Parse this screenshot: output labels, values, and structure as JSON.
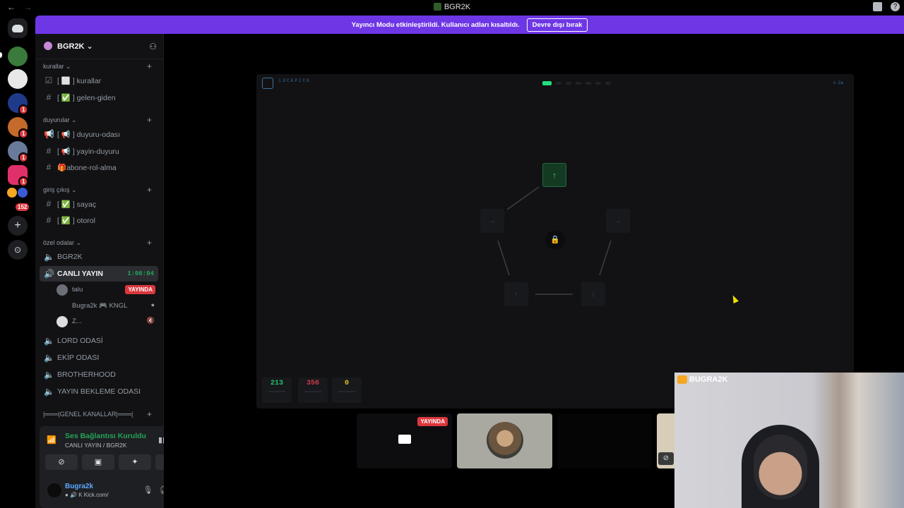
{
  "window": {
    "title": "BGR2K",
    "back": "←",
    "forward": "→"
  },
  "banner": {
    "text": "Yayıncı Modu etkinleştirildi. Kullanıcı adları kısaltıldı.",
    "button": "Devre dışı bırak"
  },
  "rail": {
    "badges": [
      "1",
      "1",
      "1",
      "1",
      "152"
    ],
    "add": "+",
    "explore": "⊙"
  },
  "server": {
    "name": "BGR2K ⌄"
  },
  "categories": {
    "kurallar": "kurallar ⌄",
    "duyurular": "duyurular ⌄",
    "giris": "giriş çıkış ⌄",
    "ozel": "özel odalar ⌄",
    "genel": "|═══|GENEL KANALLAR|═══|"
  },
  "channels": {
    "kurallar": "[ ⬜ ] kurallar",
    "gelen": "[ ✅ ] gelen-giden",
    "duyuru_odasi": "[ 📢 ] duyuru-odası",
    "yayin_duyuru": "[ 📢 ] yayin-duyuru",
    "abone": "🎁abone-rol-alma",
    "sayac": "[ ✅ ] sayaç",
    "otorol": "[ ✅ ] otorol",
    "bgr2k": "BGR2K",
    "canli": "CANLI YAYIN",
    "canli_timer": "1:06:04",
    "lord": "LORD ODASİ",
    "ekip": "EKİP ODASI",
    "brotherhood": "BROTHERHOOD",
    "bekleme": "YAYIN BEKLEME ODASI"
  },
  "voice_users": [
    {
      "name": "talu",
      "badge": "YAYINDA"
    },
    {
      "name": "Bugra2k 🎮 KNGL",
      "badge": ""
    },
    {
      "name": "Z...",
      "badge": ""
    }
  ],
  "voice_panel": {
    "status": "Ses Bağlantısı Kuruldu",
    "location": "CANLI YAYIN / BGR2K"
  },
  "user": {
    "name": "Bugra2k",
    "status": "● 🔊 K Kick.com/"
  },
  "game": {
    "header": "LOCKPICK",
    "version": "v.2a",
    "progress_step": 1,
    "progress_total": 7,
    "nodes": {
      "top": "↑",
      "left": "→",
      "right": "→",
      "bottom_left": "↑",
      "bottom_right": "↓"
    },
    "lock": "🔒",
    "stats": [
      {
        "value": "213",
        "color": "#23c26b"
      },
      {
        "value": "356",
        "color": "#d0384a"
      },
      {
        "value": "0",
        "color": "#e0c020"
      }
    ]
  },
  "tiles": {
    "live": "YAYINDA"
  },
  "webcam": {
    "label": "BUGRA2K"
  },
  "colors": {
    "accent": "#6e37e6",
    "green": "#23a55a",
    "red": "#da373c"
  }
}
